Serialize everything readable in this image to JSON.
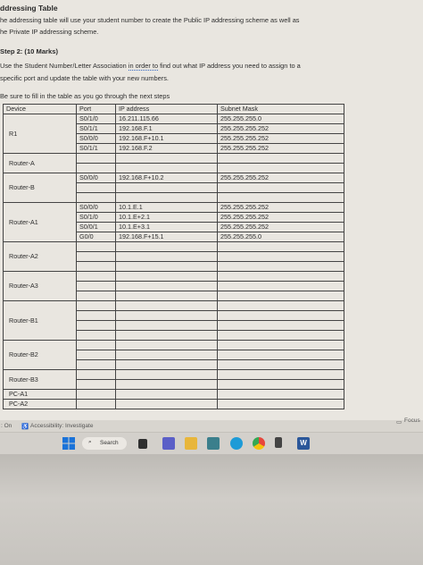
{
  "document": {
    "section_title": "ddressing Table",
    "intro_line1": "he addressing table will use your student number to create the Public IP addressing scheme as well as",
    "intro_line2": "he Private IP addressing scheme.",
    "step_heading": "Step 2: (10 Marks)",
    "instr_line1_a": "Use the Student Number/Letter Association ",
    "instr_line1_link": "in order to",
    "instr_line1_b": " find out what IP address you need to assign to a",
    "instr_line2": "specific port and update the table with your new numbers.",
    "fill_note": "Be sure to fill in the table as you go through the next steps"
  },
  "table": {
    "headers": [
      "Device",
      "Port",
      "IP address",
      "Subnet Mask"
    ],
    "rows": [
      {
        "device": "R1",
        "entries": [
          {
            "port": "S0/1/0",
            "ip": "16.211.115.66",
            "mask": "255.255.255.0"
          },
          {
            "port": "S0/1/1",
            "ip": "192.168.F.1",
            "mask": "255.255.255.252"
          },
          {
            "port": "S0/0/0",
            "ip": "192.168.F+10.1",
            "mask": "255.255.255.252"
          },
          {
            "port": "S0/1/1",
            "ip": "192.168.F.2",
            "mask": "255.255.255.252"
          }
        ]
      },
      {
        "device": "Router-A",
        "entries": [
          {
            "port": "",
            "ip": "",
            "mask": ""
          },
          {
            "port": "",
            "ip": "",
            "mask": ""
          }
        ]
      },
      {
        "device": "Router-B",
        "entries": [
          {
            "port": "S0/0/0",
            "ip": "192.168.F+10.2",
            "mask": "255.255.255.252"
          },
          {
            "port": "",
            "ip": "",
            "mask": ""
          },
          {
            "port": "",
            "ip": "",
            "mask": ""
          }
        ]
      },
      {
        "device": "Router-A1",
        "entries": [
          {
            "port": "S0/0/0",
            "ip": "10.1.E.1",
            "mask": "255.255.255.252"
          },
          {
            "port": "S0/1/0",
            "ip": "10.1.E+2.1",
            "mask": "255.255.255.252"
          },
          {
            "port": "S0/0/1",
            "ip": "10.1.E+3.1",
            "mask": "255.255.255.252"
          },
          {
            "port": "G0/0",
            "ip": "192.168.F+15.1",
            "mask": "255.255.255.0"
          }
        ]
      },
      {
        "device": "Router-A2",
        "entries": [
          {
            "port": "",
            "ip": "",
            "mask": ""
          },
          {
            "port": "",
            "ip": "",
            "mask": ""
          },
          {
            "port": "",
            "ip": "",
            "mask": ""
          }
        ]
      },
      {
        "device": "Router-A3",
        "entries": [
          {
            "port": "",
            "ip": "",
            "mask": ""
          },
          {
            "port": "",
            "ip": "",
            "mask": ""
          },
          {
            "port": "",
            "ip": "",
            "mask": ""
          }
        ]
      },
      {
        "device": "Router-B1",
        "entries": [
          {
            "port": "",
            "ip": "",
            "mask": ""
          },
          {
            "port": "",
            "ip": "",
            "mask": ""
          },
          {
            "port": "",
            "ip": "",
            "mask": ""
          },
          {
            "port": "",
            "ip": "",
            "mask": ""
          }
        ]
      },
      {
        "device": "Router-B2",
        "entries": [
          {
            "port": "",
            "ip": "",
            "mask": ""
          },
          {
            "port": "",
            "ip": "",
            "mask": ""
          },
          {
            "port": "",
            "ip": "",
            "mask": ""
          }
        ]
      },
      {
        "device": "Router-B3",
        "entries": [
          {
            "port": "",
            "ip": "",
            "mask": ""
          },
          {
            "port": "",
            "ip": "",
            "mask": ""
          }
        ]
      },
      {
        "device": "PC-A1",
        "entries": [
          {
            "port": "",
            "ip": "",
            "mask": ""
          }
        ]
      },
      {
        "device": "PC-A2",
        "entries": [
          {
            "port": "",
            "ip": "",
            "mask": ""
          }
        ]
      }
    ]
  },
  "statusbar": {
    "left_text": ": On",
    "accessibility": "Accessibility: Investigate",
    "focus": "Focus"
  },
  "taskbar": {
    "search_label": "Search",
    "colors": {
      "windows": "#1a73d9",
      "word": "#2b579a",
      "chrome": "#e8453c"
    }
  }
}
